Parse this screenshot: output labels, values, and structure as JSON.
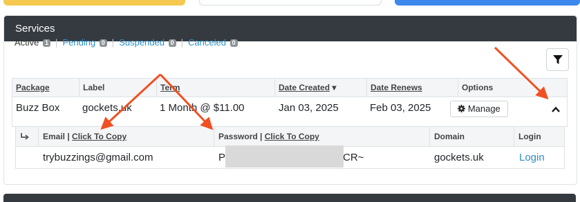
{
  "services": {
    "title": "Services",
    "filters": [
      {
        "label": "Active",
        "count": "1"
      },
      {
        "label": "Pending",
        "count": "0"
      },
      {
        "label": "Suspended",
        "count": "0"
      },
      {
        "label": "Canceled",
        "count": "0"
      }
    ],
    "columns": {
      "package": "Package",
      "label": "Label",
      "term": "Term",
      "date_created": "Date Created",
      "date_renews": "Date Renews",
      "options": "Options"
    },
    "row": {
      "package": "Buzz Box",
      "label": "gockets.uk",
      "term": "1 Month @ $11.00",
      "date_created": "Jan 03, 2025",
      "date_renews": "Feb 03, 2025",
      "manage": "Manage"
    },
    "details": {
      "columns": {
        "email": "Email",
        "password": "Password",
        "click_to_copy": "Click To Copy",
        "domain": "Domain",
        "login": "Login"
      },
      "email": "trybuzzings@gmail.com",
      "password_start": "Pe",
      "password_end": "CR~",
      "domain": "gockets.uk",
      "login": "Login"
    }
  },
  "colors": {
    "header_bg": "#343a40",
    "link": "#2d8fc2",
    "badge": "#8e9398",
    "annotation_arrow": "#f05022"
  }
}
